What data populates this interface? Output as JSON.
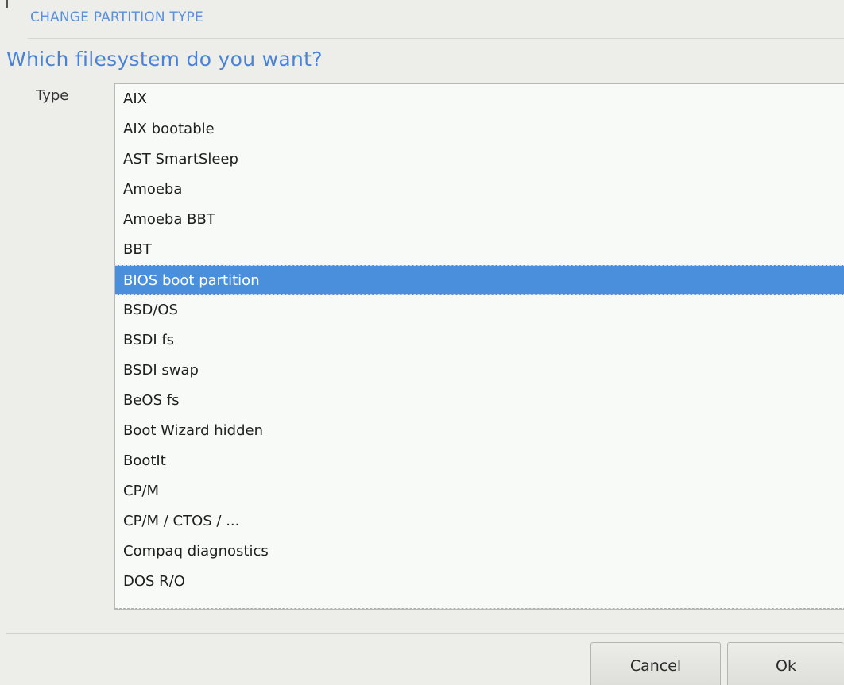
{
  "header": {
    "title": "CHANGE PARTITION TYPE"
  },
  "question": "Which filesystem do you want?",
  "type_label": "Type",
  "list": {
    "items": [
      "AIX",
      "AIX bootable",
      "AST SmartSleep",
      "Amoeba",
      "Amoeba BBT",
      "BBT",
      "BIOS boot partition",
      "BSD/OS",
      "BSDI fs",
      "BSDI swap",
      "BeOS fs",
      "Boot Wizard hidden",
      "BootIt",
      "CP/M",
      "CP/M / CTOS / ...",
      "Compaq diagnostics",
      "DOS R/O"
    ],
    "selected": "BIOS boot partition",
    "selected_color": "#4a8fdc"
  },
  "buttons": {
    "cancel_label": "Cancel",
    "ok_label": "Ok"
  },
  "colors": {
    "accent": "#4a82d4",
    "background": "#ededea",
    "list_background": "#f7faf7"
  }
}
